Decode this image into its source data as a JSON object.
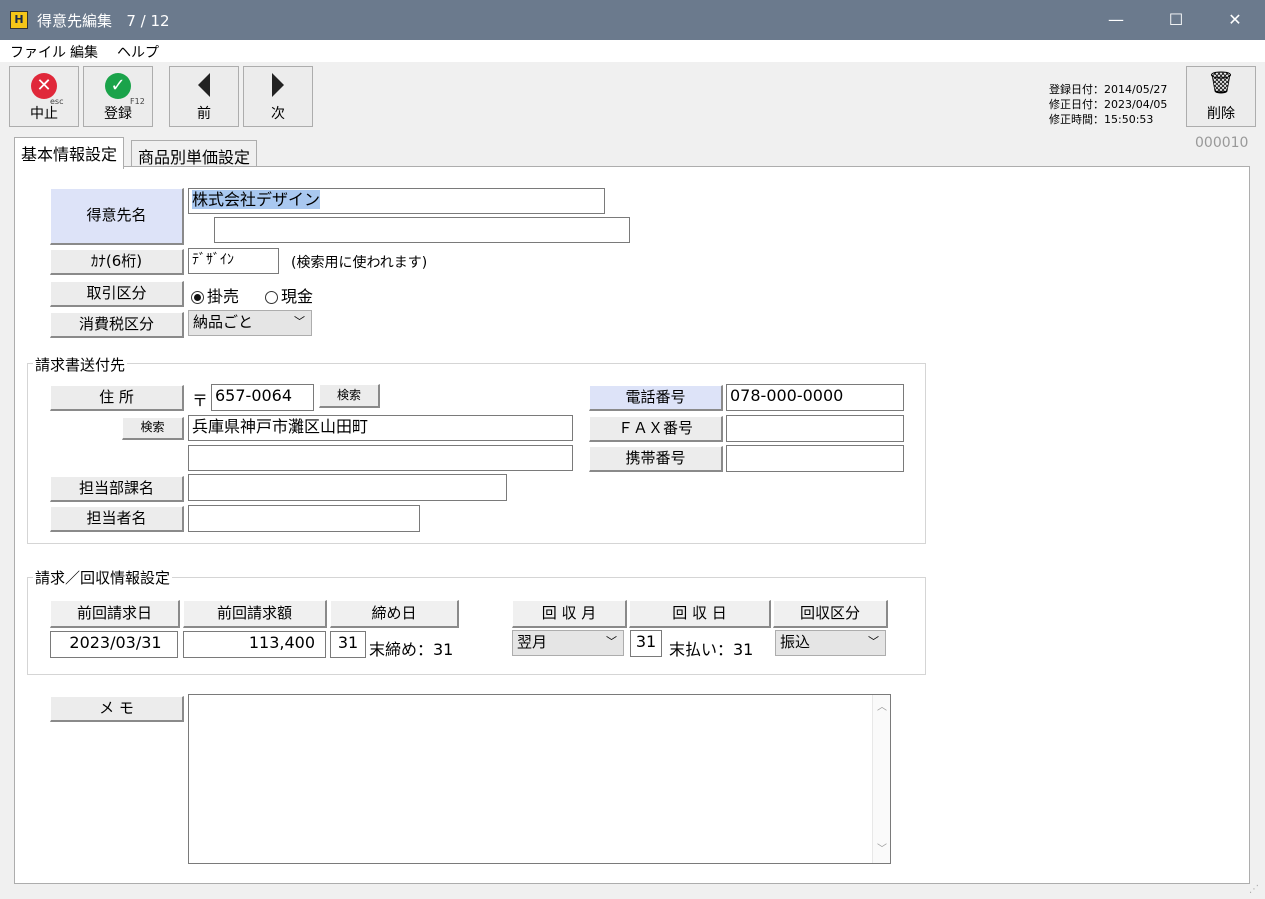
{
  "window": {
    "title": "得意先編集",
    "record_pos": "7 / 12",
    "app_icon": "H",
    "minimize_icon": "—",
    "maximize_icon": "☐",
    "close_icon": "✕"
  },
  "menu": [
    "ファイル",
    "編集",
    "ヘルプ"
  ],
  "toolbar": {
    "cancel": {
      "label": "中止",
      "key": "esc",
      "icon": "✕"
    },
    "register": {
      "label": "登録",
      "key": "F12",
      "icon": "✓"
    },
    "prev": {
      "label": "前"
    },
    "next": {
      "label": "次"
    },
    "delete": {
      "label": "削除",
      "icon": "🗑"
    },
    "info": [
      "登録日付：2014/05/27",
      "修正日付：2023/04/05",
      "修正時間：15:50:53"
    ]
  },
  "tabs": [
    "基本情報設定",
    "商品別単価設定"
  ],
  "record_no": "000010",
  "basic": {
    "name_label": "得意先名",
    "name_value": "株式会社デザイン",
    "name_value2": "",
    "kana_label": "ｶﾅ(6桁)",
    "kana_value": "ﾃﾞｻﾞｲﾝ",
    "kana_note": "(検索用に使われます)",
    "torihiki_label": "取引区分",
    "radio1": "掛売",
    "radio2": "現金",
    "tax_label": "消費税区分",
    "tax_value": "納品ごと"
  },
  "invoice": {
    "group_title": "請求書送付先",
    "address_label": "住 所",
    "postal_mark": "〒",
    "postal": "657-0064",
    "search_label": "検索",
    "search2_label": "検索",
    "address1": "兵庫県神戸市灘区山田町",
    "address2": "",
    "dept_label": "担当部課名",
    "dept_value": "",
    "person_label": "担当者名",
    "person_value": "",
    "tel_label": "電話番号",
    "tel_value": "078-000-0000",
    "fax_label": "ＦＡＸ番号",
    "fax_value": "",
    "mobile_label": "携帯番号",
    "mobile_value": ""
  },
  "billing": {
    "group_title": "請求／回収情報設定",
    "h_prev_date": "前回請求日",
    "h_prev_amount": "前回請求額",
    "h_close": "締め日",
    "h_month": "回 収 月",
    "h_day": "回 収 日",
    "h_kind": "回収区分",
    "prev_date": "2023/03/31",
    "prev_amount": "113,400",
    "close_day": "31",
    "close_note": "末締め：31",
    "month": "翌月",
    "day": "31",
    "day_note": "末払い：31",
    "kind": "振込"
  },
  "memo": {
    "label": "メ モ",
    "value": ""
  }
}
